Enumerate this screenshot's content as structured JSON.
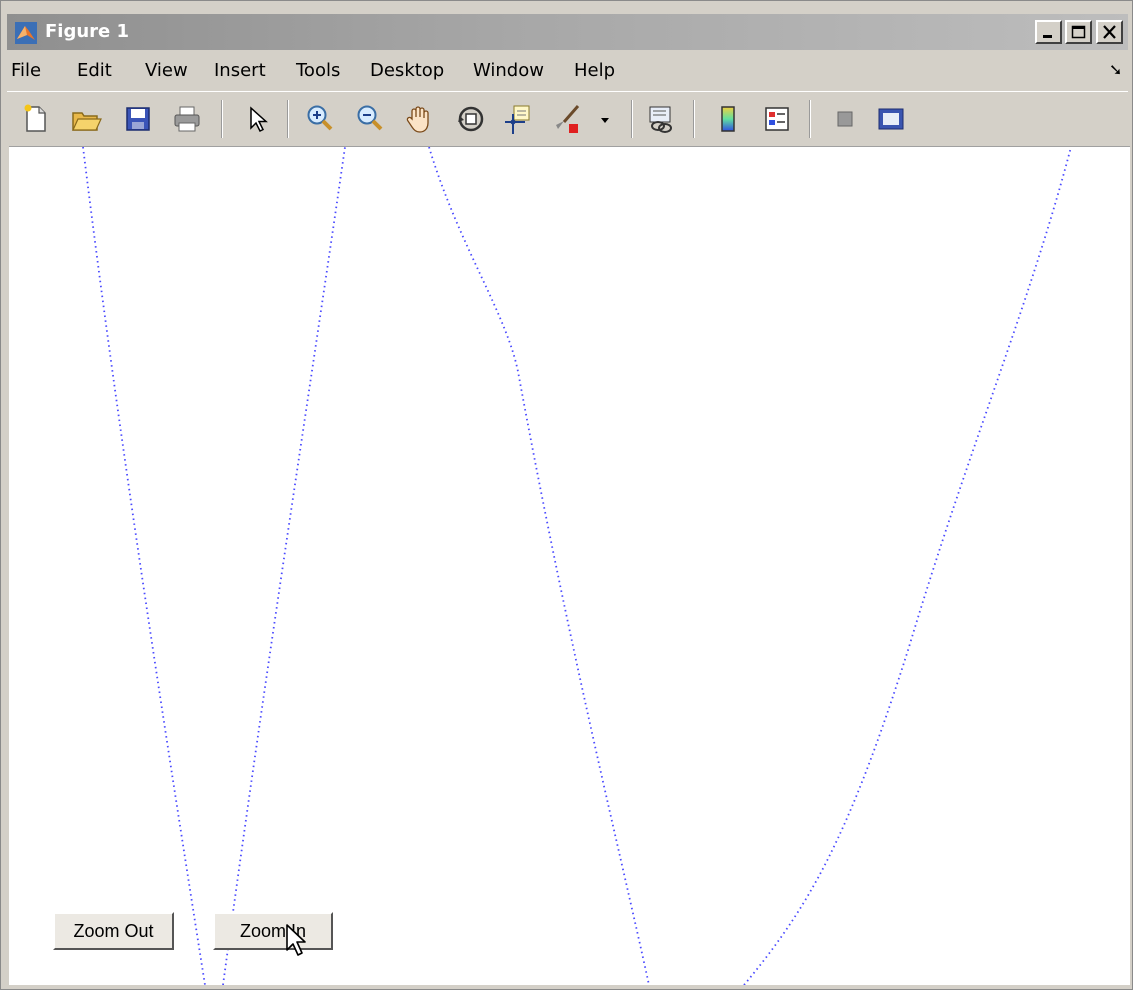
{
  "window": {
    "title": "Figure 1"
  },
  "menu": [
    "File",
    "Edit",
    "View",
    "Insert",
    "Tools",
    "Desktop",
    "Window",
    "Help"
  ],
  "toolbar": {
    "items": [
      "new-figure-icon",
      "open-file-icon",
      "save-icon",
      "print-icon",
      "edit-plot-arrow-icon",
      "zoom-in-icon",
      "zoom-out-icon",
      "pan-hand-icon",
      "rotate-3d-icon",
      "data-cursor-icon",
      "brush-icon",
      "link-plot-icon",
      "colorbar-icon",
      "legend-icon",
      "hide-plot-tools-icon",
      "show-plot-tools-icon"
    ]
  },
  "buttons": {
    "zoom_out": "Zoom Out",
    "zoom_in": "Zoom In"
  },
  "colors": {
    "line": "#4a4aff",
    "titlebar": "#9e9e9e",
    "chrome": "#d4d0c8"
  },
  "chart_data": {
    "type": "line",
    "title": "",
    "xlabel": "",
    "ylabel": "",
    "grid": false,
    "line_style": "dotted",
    "series": [
      {
        "color": "#4a4aff"
      }
    ]
  }
}
